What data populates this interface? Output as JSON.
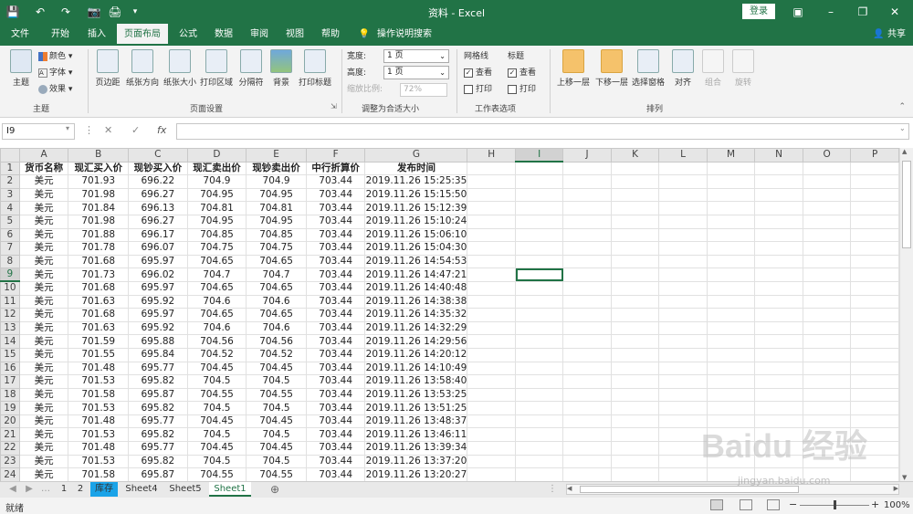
{
  "title_bar": {
    "doc_title": "资料 - Excel",
    "login": "登录"
  },
  "ribbon_tabs": [
    "文件",
    "开始",
    "插入",
    "页面布局",
    "公式",
    "数据",
    "审阅",
    "视图",
    "帮助",
    "操作说明搜索"
  ],
  "active_tab": "页面布局",
  "share": "共享",
  "ribbon": {
    "theme": {
      "label": "主题",
      "colors": "颜色",
      "fonts": "字体",
      "effects": "效果",
      "group": "主题"
    },
    "page_setup": {
      "buttons": [
        "页边距",
        "纸张方向",
        "纸张大小",
        "打印区域",
        "分隔符",
        "背景",
        "打印标题"
      ],
      "group": "页面设置"
    },
    "scale": {
      "width_label": "宽度:",
      "width_value": "1 页",
      "height_label": "高度:",
      "height_value": "1 页",
      "scale_label": "缩放比例:",
      "scale_value": "72%",
      "group": "调整为合适大小"
    },
    "sheet_options": {
      "gridlines": "网格线",
      "headings": "标题",
      "view": "查看",
      "print": "打印",
      "group": "工作表选项"
    },
    "arrange": {
      "buttons": [
        "上移一层",
        "下移一层",
        "选择窗格",
        "对齐",
        "组合",
        "旋转"
      ],
      "group": "排列"
    }
  },
  "formula_bar": {
    "name_box": "I9",
    "fx": "fx",
    "cancel": "✕",
    "enter": "✓"
  },
  "column_headers": [
    "A",
    "B",
    "C",
    "D",
    "E",
    "F",
    "G",
    "H",
    "I",
    "J",
    "K",
    "L",
    "M",
    "N",
    "O",
    "P"
  ],
  "selected_cell": "I9",
  "table": {
    "header": [
      "货币名称",
      "现汇买入价",
      "现钞买入价",
      "现汇卖出价",
      "现钞卖出价",
      "中行折算价",
      "发布时间"
    ],
    "rows": [
      [
        "美元",
        "701.93",
        "696.22",
        "704.9",
        "704.9",
        "703.44",
        "2019.11.26 15:25:35"
      ],
      [
        "美元",
        "701.98",
        "696.27",
        "704.95",
        "704.95",
        "703.44",
        "2019.11.26 15:15:50"
      ],
      [
        "美元",
        "701.84",
        "696.13",
        "704.81",
        "704.81",
        "703.44",
        "2019.11.26 15:12:39"
      ],
      [
        "美元",
        "701.98",
        "696.27",
        "704.95",
        "704.95",
        "703.44",
        "2019.11.26 15:10:24"
      ],
      [
        "美元",
        "701.88",
        "696.17",
        "704.85",
        "704.85",
        "703.44",
        "2019.11.26 15:06:10"
      ],
      [
        "美元",
        "701.78",
        "696.07",
        "704.75",
        "704.75",
        "703.44",
        "2019.11.26 15:04:30"
      ],
      [
        "美元",
        "701.68",
        "695.97",
        "704.65",
        "704.65",
        "703.44",
        "2019.11.26 14:54:53"
      ],
      [
        "美元",
        "701.73",
        "696.02",
        "704.7",
        "704.7",
        "703.44",
        "2019.11.26 14:47:21"
      ],
      [
        "美元",
        "701.68",
        "695.97",
        "704.65",
        "704.65",
        "703.44",
        "2019.11.26 14:40:48"
      ],
      [
        "美元",
        "701.63",
        "695.92",
        "704.6",
        "704.6",
        "703.44",
        "2019.11.26 14:38:38"
      ],
      [
        "美元",
        "701.68",
        "695.97",
        "704.65",
        "704.65",
        "703.44",
        "2019.11.26 14:35:32"
      ],
      [
        "美元",
        "701.63",
        "695.92",
        "704.6",
        "704.6",
        "703.44",
        "2019.11.26 14:32:29"
      ],
      [
        "美元",
        "701.59",
        "695.88",
        "704.56",
        "704.56",
        "703.44",
        "2019.11.26 14:29:56"
      ],
      [
        "美元",
        "701.55",
        "695.84",
        "704.52",
        "704.52",
        "703.44",
        "2019.11.26 14:20:12"
      ],
      [
        "美元",
        "701.48",
        "695.77",
        "704.45",
        "704.45",
        "703.44",
        "2019.11.26 14:10:49"
      ],
      [
        "美元",
        "701.53",
        "695.82",
        "704.5",
        "704.5",
        "703.44",
        "2019.11.26 13:58:40"
      ],
      [
        "美元",
        "701.58",
        "695.87",
        "704.55",
        "704.55",
        "703.44",
        "2019.11.26 13:53:25"
      ],
      [
        "美元",
        "701.53",
        "695.82",
        "704.5",
        "704.5",
        "703.44",
        "2019.11.26 13:51:25"
      ],
      [
        "美元",
        "701.48",
        "695.77",
        "704.45",
        "704.45",
        "703.44",
        "2019.11.26 13:48:37"
      ],
      [
        "美元",
        "701.53",
        "695.82",
        "704.5",
        "704.5",
        "703.44",
        "2019.11.26 13:46:11"
      ],
      [
        "美元",
        "701.48",
        "695.77",
        "704.45",
        "704.45",
        "703.44",
        "2019.11.26 13:39:34"
      ],
      [
        "美元",
        "701.53",
        "695.82",
        "704.5",
        "704.5",
        "703.44",
        "2019.11.26 13:37:20"
      ],
      [
        "美元",
        "701.58",
        "695.87",
        "704.55",
        "704.55",
        "703.44",
        "2019.11.26 13:20:27"
      ]
    ]
  },
  "sheet_tabs": [
    "1",
    "2",
    "库存",
    "Sheet4",
    "Sheet5",
    "Sheet1"
  ],
  "active_sheet": "Sheet1",
  "highlighted_sheet": "库存",
  "status": {
    "ready": "就绪",
    "zoom": "100%",
    "zoom_level": 0.5
  },
  "watermark": {
    "logo": "Baidu 经验",
    "url": "jingyan.baidu.com"
  }
}
